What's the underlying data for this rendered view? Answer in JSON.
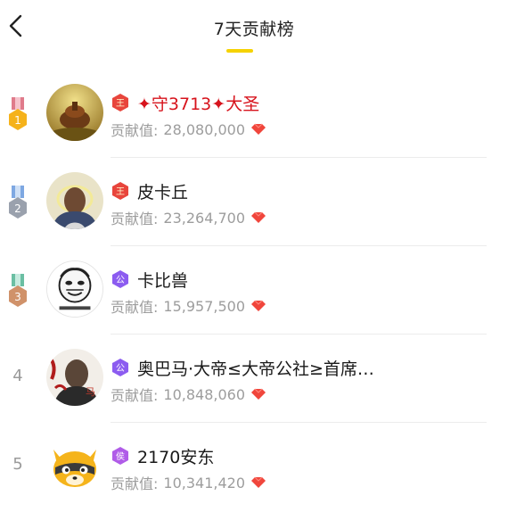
{
  "header": {
    "title": "7天贡献榜"
  },
  "colors": {
    "accent": "#f5d200",
    "gold": "#f5b21b",
    "silver": "#9aa1ad",
    "bronze": "#d0926a",
    "red_name": "#d7131c",
    "gem": "#f0463c"
  },
  "icons": {
    "back": "chevron-left-icon",
    "diamond": "ruby-gem-icon"
  },
  "leaderboard": [
    {
      "rank": "1",
      "medal": "gold",
      "badge_label": "王",
      "badge_color": "#e8453c",
      "name": "✦守3713✦大圣",
      "name_red": true,
      "contrib_label": "贡献值:",
      "contrib_value": "28,080,000"
    },
    {
      "rank": "2",
      "medal": "silver",
      "badge_label": "王",
      "badge_color": "#e8453c",
      "name": "皮卡丘",
      "name_red": false,
      "contrib_label": "贡献值:",
      "contrib_value": "23,264,700"
    },
    {
      "rank": "3",
      "medal": "bronze",
      "badge_label": "公",
      "badge_color": "#8c5cf0",
      "name": "卡比兽",
      "name_red": false,
      "contrib_label": "贡献值:",
      "contrib_value": "15,957,500"
    },
    {
      "rank": "4",
      "medal": null,
      "badge_label": "公",
      "badge_color": "#8c5cf0",
      "name": "奥巴马·大帝≤大帝公社≥首席…",
      "name_red": false,
      "contrib_label": "贡献值:",
      "contrib_value": "10,848,060"
    },
    {
      "rank": "5",
      "medal": null,
      "badge_label": "侯",
      "badge_color": "#b05ce8",
      "name": "2170安东",
      "name_red": false,
      "contrib_label": "贡献值:",
      "contrib_value": "10,341,420"
    }
  ]
}
